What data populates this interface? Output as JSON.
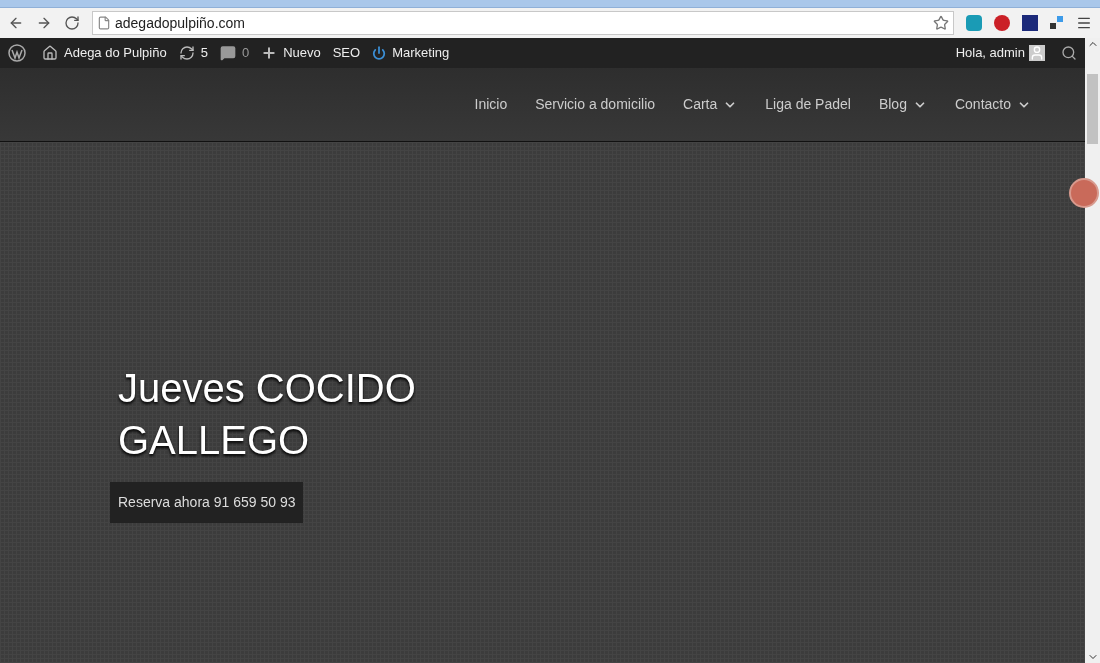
{
  "browser": {
    "url": "adegadopulpiño.com"
  },
  "admin_bar": {
    "items": [
      {
        "kind": "site",
        "label": "Adega do Pulpiño"
      },
      {
        "kind": "updates",
        "label": "5"
      },
      {
        "kind": "comments",
        "label": "0"
      },
      {
        "kind": "new",
        "label": "Nuevo"
      },
      {
        "kind": "plain",
        "label": "SEO"
      },
      {
        "kind": "marketing",
        "label": "Marketing"
      }
    ],
    "greeting": "Hola, admin"
  },
  "nav": [
    {
      "label": "Inicio",
      "has_dropdown": false
    },
    {
      "label": "Servicio a domicilio",
      "has_dropdown": false
    },
    {
      "label": "Carta",
      "has_dropdown": true
    },
    {
      "label": "Liga de Padel",
      "has_dropdown": false
    },
    {
      "label": "Blog",
      "has_dropdown": true
    },
    {
      "label": "Contacto",
      "has_dropdown": true
    }
  ],
  "hero": {
    "title": "Jueves COCIDO GALLEGO",
    "button": "Reserva ahora 91 659 50 93"
  }
}
